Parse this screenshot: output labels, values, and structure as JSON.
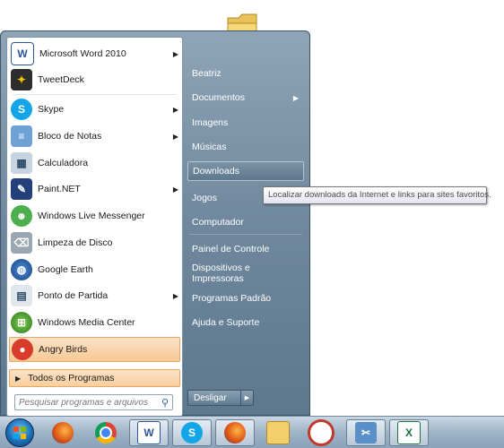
{
  "programs": [
    {
      "label": "Microsoft Word 2010",
      "icon": "word-icon",
      "has_submenu": true
    },
    {
      "label": "TweetDeck",
      "icon": "tweetdeck-icon",
      "has_submenu": false
    },
    {
      "label": "Skype",
      "icon": "skype-icon",
      "has_submenu": true
    },
    {
      "label": "Bloco de Notas",
      "icon": "notepad-icon",
      "has_submenu": true
    },
    {
      "label": "Calculadora",
      "icon": "calculator-icon",
      "has_submenu": false
    },
    {
      "label": "Paint.NET",
      "icon": "paintnet-icon",
      "has_submenu": true
    },
    {
      "label": "Windows Live Messenger",
      "icon": "messenger-icon",
      "has_submenu": false
    },
    {
      "label": "Limpeza de Disco",
      "icon": "disk-cleanup-icon",
      "has_submenu": false
    },
    {
      "label": "Google Earth",
      "icon": "google-earth-icon",
      "has_submenu": false
    },
    {
      "label": "Ponto de Partida",
      "icon": "getting-started-icon",
      "has_submenu": true
    },
    {
      "label": "Windows Media Center",
      "icon": "media-center-icon",
      "has_submenu": false
    },
    {
      "label": "Angry Birds",
      "icon": "angry-birds-icon",
      "has_submenu": false,
      "highlighted": true
    }
  ],
  "all_programs": {
    "label": "Todos os Programas"
  },
  "search": {
    "placeholder": "Pesquisar programas e arquivos"
  },
  "right_pane": {
    "items": [
      {
        "label": "Beatriz"
      },
      {
        "label": "Documentos",
        "has_submenu": true
      },
      {
        "label": "Imagens"
      },
      {
        "label": "Músicas"
      },
      {
        "label": "Downloads",
        "hovered": true
      },
      {
        "label": "Jogos"
      },
      {
        "label": "Computador"
      },
      {
        "label": "Painel de Controle"
      },
      {
        "label": "Dispositivos e Impressoras"
      },
      {
        "label": "Programas Padrão"
      },
      {
        "label": "Ajuda e Suporte"
      }
    ]
  },
  "shutdown": {
    "label": "Desligar"
  },
  "tooltip": {
    "text": "Localizar downloads da Internet e links para sites favoritos."
  },
  "taskbar": {
    "items": [
      {
        "icon": "start-orb-icon"
      },
      {
        "icon": "firefox-icon"
      },
      {
        "icon": "chrome-icon"
      },
      {
        "icon": "word-icon"
      },
      {
        "icon": "skype-icon"
      },
      {
        "icon": "firefox-icon"
      },
      {
        "icon": "explorer-folder-icon"
      },
      {
        "icon": "magnifier-icon"
      },
      {
        "icon": "screen-capture-icon"
      },
      {
        "icon": "excel-icon"
      }
    ]
  },
  "colors": {
    "menu_bg": "#6f889d",
    "highlight": "#f8c994",
    "tooltip_border": "#767676"
  }
}
